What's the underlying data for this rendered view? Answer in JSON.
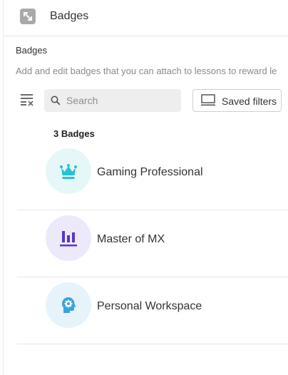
{
  "header": {
    "title": "Badges",
    "icon": "expand-icon"
  },
  "section": {
    "title": "Badges",
    "description": "Add and edit badges that you can attach to lessons to reward le"
  },
  "filters": {
    "toggle_icon": "filter-list-icon",
    "search": {
      "placeholder": "Search",
      "value": ""
    },
    "saved_filters_label": "Saved filters"
  },
  "list": {
    "count_label": "3 Badges",
    "badges": [
      {
        "name": "Gaming Professional",
        "icon": "crown-icon",
        "icon_color": "#27c2d3",
        "icon_bg": "#e6f7f8"
      },
      {
        "name": "Master of MX",
        "icon": "bar-chart-icon",
        "icon_color": "#5b35c8",
        "icon_bg": "#ece9fa"
      },
      {
        "name": "Personal Workspace",
        "icon": "head-gear-icon",
        "icon_color": "#3ba3e0",
        "icon_bg": "#e6f3fb"
      }
    ]
  }
}
